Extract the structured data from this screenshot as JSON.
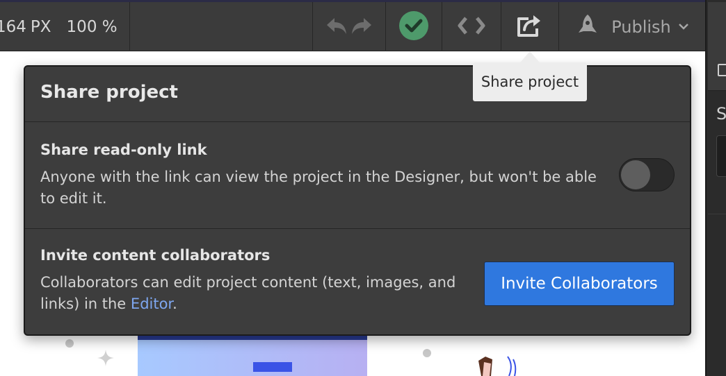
{
  "toolbar": {
    "width_value": "164",
    "width_unit": "PX",
    "zoom": "100 %",
    "undo_icon": "undo-icon",
    "redo_icon": "redo-icon",
    "status_icon": "checkmark-circle-icon",
    "code_icon": "code-brackets-icon",
    "share_icon": "share-icon",
    "publish_icon": "rocket-icon",
    "publish_label": "Publish",
    "status_color": "#4e9a6b"
  },
  "right_panel": {
    "label_initial": "S"
  },
  "tooltip": {
    "text": "Share project"
  },
  "share_popover": {
    "title": "Share project",
    "read_only": {
      "title": "Share read-only link",
      "description": "Anyone with the link can view the project in the Designer, but won't be able to edit it.",
      "toggle_on": false
    },
    "collaborators": {
      "title": "Invite content collaborators",
      "description_before": "Collaborators can edit project content (text, images, and links) in the ",
      "description_link": "Editor",
      "description_after": ".",
      "button_label": "Invite Collaborators",
      "button_color": "#2f78df"
    }
  }
}
